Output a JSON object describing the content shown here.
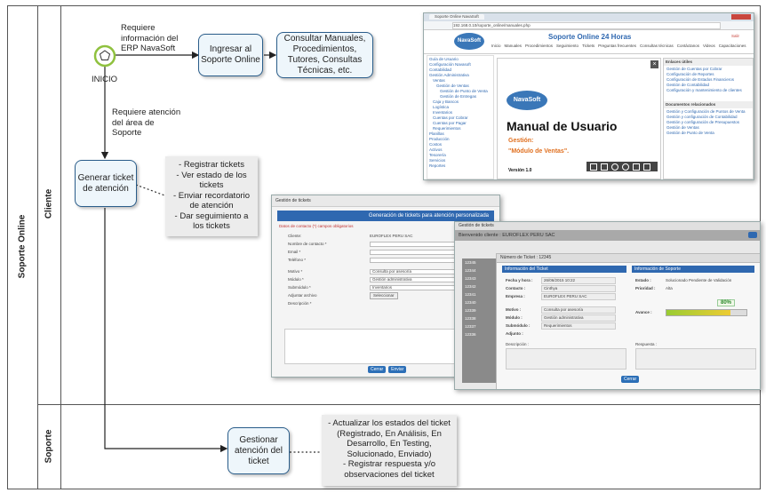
{
  "pool": {
    "title": "Soporte Online"
  },
  "lanes": {
    "cliente": "Cliente",
    "soporte": "Soporte"
  },
  "start_event": {
    "label": "INICIO"
  },
  "flow_labels": {
    "requiere_info": "Requiere información del ERP NavaSoft",
    "requiere_atencion": "Requiere atención del área de Soporte"
  },
  "tasks": {
    "ingresar": "Ingresar al Soporte Online",
    "consultar": "Consultar Manuales, Procedimientos, Tutores, Consultas Técnicas, etc.",
    "generar": "Generar ticket de atención",
    "gestionar": "Gestionar atención del ticket"
  },
  "annotations": {
    "cliente": [
      "- Registrar tickets",
      "- Ver estado de los tickets",
      "- Enviar recordatorio de atención",
      "- Dar seguimiento a los tickets"
    ],
    "soporte": [
      "- Actualizar los estados del ticket (Registrado, En Análisis, En Desarrollo, En Testing, Solucionado, Enviado)",
      "- Registrar respuesta y/o observaciones del ticket"
    ]
  },
  "screenshot_portal": {
    "tab": "Soporte Online NavaSoft",
    "url": "192.168.0.10/soporte_online/manuales.php",
    "logo": "NavaSoft",
    "header_title": "Soporte Online 24 Horas",
    "salir": "Salir",
    "menu": [
      "Inicio",
      "Manuales",
      "Procedimientos",
      "Seguimiento",
      "Tickets",
      "Preguntas frecuentes",
      "Consultas técnicas",
      "Contáctanos",
      "Videos",
      "Capacitaciones"
    ],
    "tree": [
      "Guía de Usuario",
      "Configuración Navasoft",
      "Contabilidad",
      "Gestión Administrativa",
      "Ventas",
      "Gestión de Ventas",
      "Gestión de Punto de Venta",
      "Gestión de Entregas",
      "Caja y Bancos",
      "Logística",
      "Inventarios",
      "Cuentas por Cobrar",
      "Cuentas por Pagar",
      "Requerimientos",
      "Planillas",
      "Producción",
      "Costos",
      "Activos",
      "Tesorería",
      "Servicios",
      "Reportes"
    ],
    "doc_logo": "NavaSoft",
    "doc_title": "Manual de Usuario",
    "doc_gestion": "Gestión:",
    "doc_module": "\"Módulo de Ventas\".",
    "doc_version": "Versión 1.0",
    "right_head1": "Enlaces útiles",
    "right_links1": [
      "Gestión de Cuentas por Cobrar",
      "Configuración de Reportes",
      "Configuración de Estados Financieros",
      "Gestión de Contabilidad",
      "Configuración y mantenimiento de clientes"
    ],
    "right_head2": "Documentos relacionados",
    "right_links2": [
      "Gestión y Configuración de Puntos de Venta",
      "Gestión y configuración de Contabilidad",
      "Gestión y configuración de Presupuestos",
      "Gestión de Ventas",
      "Gestión de Punto de Venta"
    ]
  },
  "screenshot_form": {
    "window_title": "Gestión de tickets",
    "header": "Generación de tickets para atención personalizada",
    "section": "Datos de contacto (*) campos obligatorios",
    "fields": [
      {
        "label": "Cliente:",
        "value": "EUROFLEX PERU SAC"
      },
      {
        "label": "Nombre de contacto *",
        "value": ""
      },
      {
        "label": "Email *",
        "value": ""
      },
      {
        "label": "Teléfono *",
        "value": ""
      },
      {
        "label": "Motivo *",
        "value": "Consulta por asesoría"
      },
      {
        "label": "Módulo *",
        "value": "Gestión administrativa"
      },
      {
        "label": "Submódulo *",
        "value": "Inventarios"
      },
      {
        "label": "Adjuntar archivo",
        "value": "Seleccionar"
      },
      {
        "label": "Descripción *",
        "value": ""
      }
    ],
    "btn_cerrar": "Cerrar",
    "btn_enviar": "Enviar"
  },
  "screenshot_detail": {
    "window_title": "Gestión de tickets",
    "welcome": "Bienvenido cliente : EUROFLEX PERU SAC",
    "dialog_title": "Número de Ticket : 12345",
    "left_head": "Información del Ticket",
    "right_head": "Información de Soporte",
    "info": [
      {
        "label": "Fecha y hora :",
        "value": "26/06/2015 10:22"
      },
      {
        "label": "Contacto :",
        "value": "Cinthya"
      },
      {
        "label": "Empresa :",
        "value": "EUROFLEX PERU SAC"
      },
      {
        "label": "Motivo :",
        "value": "Consulta por asesoría"
      },
      {
        "label": "Módulo :",
        "value": "Gestión administrativa"
      },
      {
        "label": "Submódulo :",
        "value": "Requerimientos"
      },
      {
        "label": "Adjunto :",
        "value": ""
      }
    ],
    "estado_label": "Estado :",
    "estado_value": "Solucionado Pendiente de Validación",
    "prioridad_label": "Prioridad :",
    "prioridad_value": "Alta",
    "avance_label": "Avance :",
    "avance_pct": "80%",
    "avance_value": 0.8,
    "descripcion_label": "Descripción :",
    "respuesta_label": "Respuesta :",
    "btn_cerrar": "Cerrar",
    "list": [
      "12345",
      "12344",
      "12343",
      "12342",
      "12341",
      "12340",
      "12339",
      "12338",
      "12337",
      "12336"
    ]
  },
  "colors": {
    "task_border": "#2a5d8a",
    "task_fill": "#eef6fb",
    "start_stroke": "#8fc13e",
    "header_blue": "#2f68b0"
  }
}
